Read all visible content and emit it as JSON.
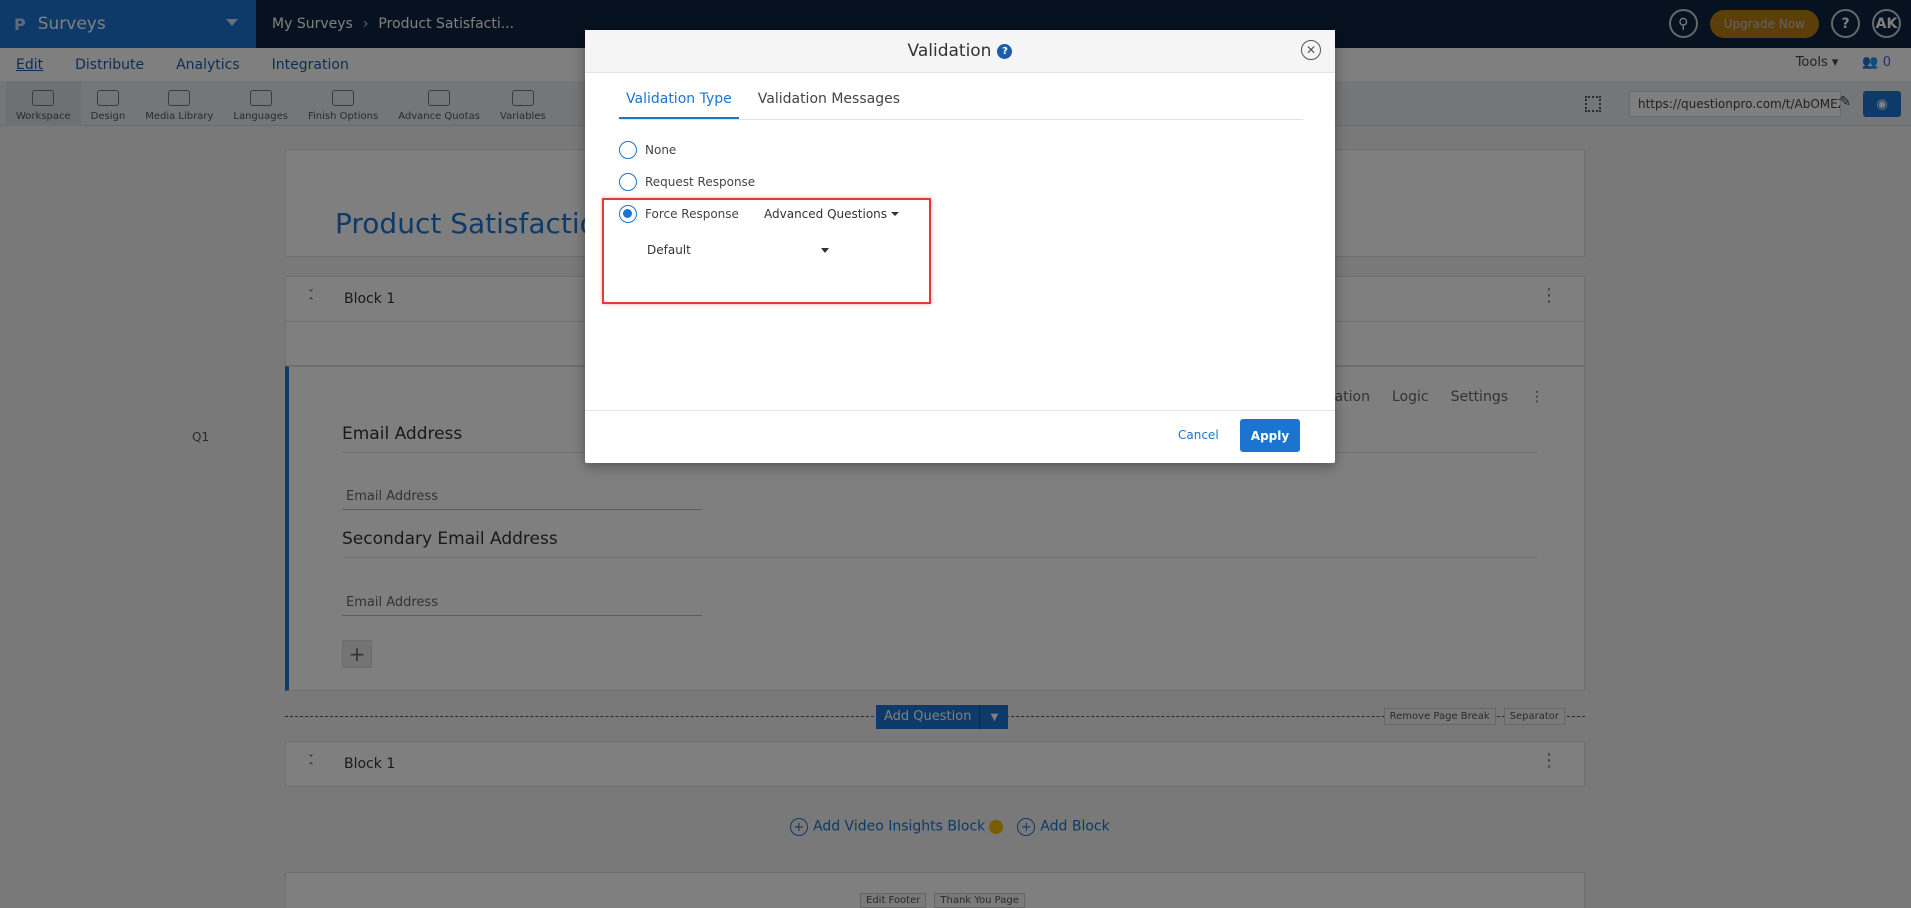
{
  "topbar": {
    "logo": "P",
    "app_name": "Surveys",
    "breadcrumb": [
      "My Surveys",
      "Product Satisfacti..."
    ],
    "upgrade_label": "Upgrade Now",
    "help_label": "?",
    "avatar_initials": "AK"
  },
  "subnav": {
    "items": [
      "Edit",
      "Distribute",
      "Analytics",
      "Integration"
    ],
    "tools_label": "Tools",
    "people_count": "0"
  },
  "toolbar": {
    "items": [
      "Workspace",
      "Design",
      "Media Library",
      "Languages",
      "Finish Options",
      "Advance Quotas",
      "Variables"
    ],
    "url": "https://questionpro.com/t/AbOMEZ"
  },
  "survey": {
    "title": "Product Satisfactio",
    "block_label": "Block 1",
    "question_number": "Q1",
    "question_actions": [
      "idation",
      "Logic",
      "Settings"
    ],
    "fields": [
      {
        "label": "Email Address",
        "placeholder": "Email Address"
      },
      {
        "label": "Secondary Email Address",
        "placeholder": "Email Address"
      }
    ],
    "add_question_label": "Add Question",
    "remove_page_break": "Remove Page Break",
    "separator": "Separator",
    "block2_label": "Block 1",
    "add_video_block": "Add Video Insights Block",
    "add_block": "Add Block",
    "edit_footer": "Edit Footer",
    "thank_you_page": "Thank You Page"
  },
  "modal": {
    "title": "Validation",
    "tabs": [
      "Validation Type",
      "Validation Messages"
    ],
    "options": [
      "None",
      "Request Response",
      "Force Response"
    ],
    "selected_option": "Force Response",
    "advanced_label": "Advanced Questions",
    "default_value": "Default",
    "cancel_label": "Cancel",
    "apply_label": "Apply"
  },
  "colors": {
    "accent": "#1b75d0",
    "topbar": "#0f2540",
    "upgrade": "#f29a00",
    "highlight": "#e53935"
  }
}
